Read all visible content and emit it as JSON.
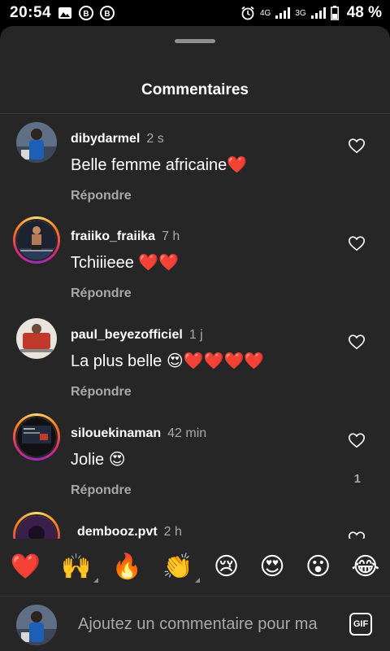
{
  "status_bar": {
    "time": "20:54",
    "battery": "48 %",
    "net1": "4G",
    "net2": "3G"
  },
  "sheet": {
    "title": "Commentaires"
  },
  "comments": [
    {
      "username": "dibydarmel",
      "time": "2 s",
      "text": "Belle femme africaine❤️",
      "reply": "Répondre",
      "likes": ""
    },
    {
      "username": "fraiiko_fraiika",
      "time": "7 h",
      "text": "Tchiiieee ❤️❤️",
      "reply": "Répondre",
      "likes": ""
    },
    {
      "username": "paul_beyezofficiel",
      "time": "1 j",
      "text": "La plus belle 😍❤️❤️❤️❤️",
      "reply": "Répondre",
      "likes": ""
    },
    {
      "username": "silouekinaman",
      "time": "42 min",
      "text": "Jolie 😍",
      "reply": "Répondre",
      "likes": "1"
    },
    {
      "username": "dembooz.pvt",
      "time": "2 h",
      "text": "",
      "reply": "",
      "likes": ""
    }
  ],
  "emoji_bar": [
    "❤️",
    "🙌",
    "🔥",
    "👏",
    "😢",
    "😍",
    "😮",
    "😂"
  ],
  "input": {
    "placeholder": "Ajoutez un commentaire pour ma",
    "gif_label": "GIF"
  },
  "colors": {
    "sheet_bg": "#262626",
    "secondary_text": "#a8a8a8",
    "heart": "#ed4956"
  }
}
